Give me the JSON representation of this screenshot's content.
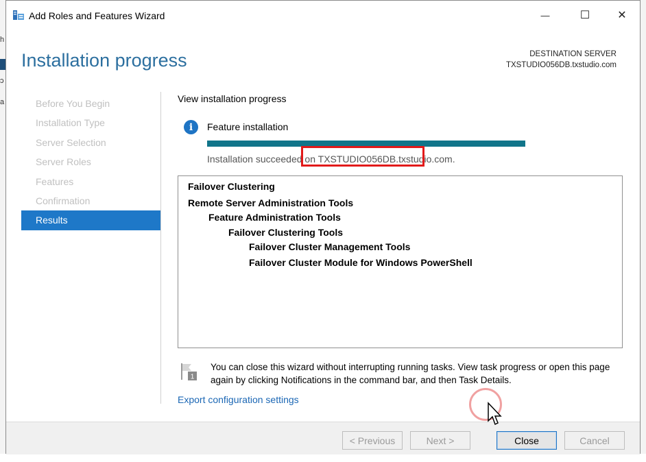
{
  "window": {
    "title": "Add Roles and Features Wizard",
    "minimize_glyph": "—",
    "maximize_glyph": "☐",
    "close_glyph": "✕"
  },
  "page": {
    "heading": "Installation progress",
    "destination_label": "DESTINATION SERVER",
    "destination_server": "TXSTUDIO056DB.txstudio.com"
  },
  "nav": {
    "items": [
      {
        "label": "Before You Begin",
        "state": "disabled"
      },
      {
        "label": "Installation Type",
        "state": "disabled"
      },
      {
        "label": "Server Selection",
        "state": "disabled"
      },
      {
        "label": "Server Roles",
        "state": "disabled"
      },
      {
        "label": "Features",
        "state": "disabled"
      },
      {
        "label": "Confirmation",
        "state": "disabled"
      },
      {
        "label": "Results",
        "state": "active"
      }
    ]
  },
  "progress": {
    "view_label": "View installation progress",
    "feature_label": "Feature installation",
    "fill_percent": 100,
    "status_text": "Installation succeeded on TXSTUDIO056DB.txstudio.com."
  },
  "results": {
    "items": [
      {
        "label": "Failover Clustering",
        "level": 0
      },
      {
        "label": "Remote Server Administration Tools",
        "level": 0
      },
      {
        "label": "Feature Administration Tools",
        "level": 1
      },
      {
        "label": "Failover Clustering Tools",
        "level": 2
      },
      {
        "label": "Failover Cluster Management Tools",
        "level": 3
      },
      {
        "label": "Failover Cluster Module for Windows PowerShell",
        "level": 3
      }
    ]
  },
  "note": {
    "text": "You can close this wizard without interrupting running tasks. View task progress or open this page again by clicking Notifications in the command bar, and then Task Details.",
    "badge": "1"
  },
  "export_link": "Export configuration settings",
  "footer": {
    "previous": "< Previous",
    "next": "Next >",
    "close": "Close",
    "cancel": "Cancel"
  },
  "colors": {
    "heading": "#2c6f9f",
    "nav_active": "#1e78c8",
    "progress_fill": "#11758a",
    "highlight": "#e21a1a",
    "link": "#1a66b4"
  }
}
